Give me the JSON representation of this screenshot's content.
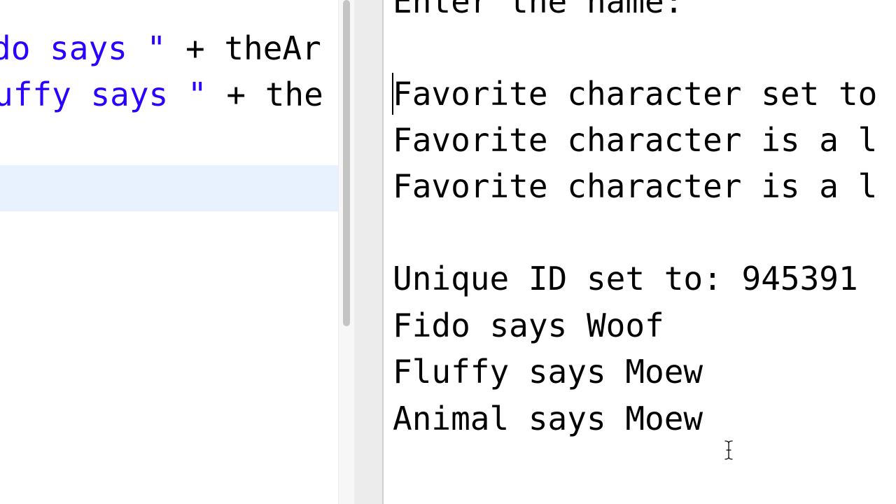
{
  "editor": {
    "lines": [
      {
        "str_part": "do says \"",
        "rest": " + theAr"
      },
      {
        "str_part": "uffy says \"",
        "rest": " + the"
      }
    ]
  },
  "console": {
    "lines": [
      "Enter the name:",
      "Favorite character set to",
      "Favorite character is a l",
      "Favorite character is a l",
      "Unique ID set to: 945391",
      "Fido says Woof",
      "Fluffy says Moew",
      "Animal says Moew"
    ]
  },
  "colors": {
    "string": "#2a00ff",
    "current_line_highlight": "#e8f2fe",
    "text": "#000000"
  },
  "icons": {
    "pointer": "ibeam-cursor-icon"
  }
}
